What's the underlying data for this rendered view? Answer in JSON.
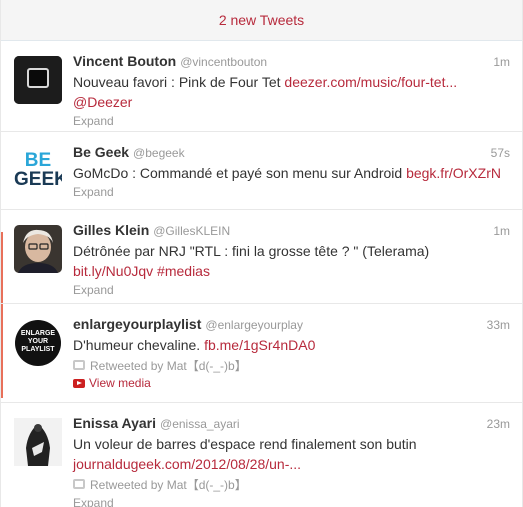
{
  "banner": {
    "label": "2 new Tweets"
  },
  "colors": {
    "accent": "#b72a3c",
    "muted": "#999999",
    "side_accent": "#e8705a"
  },
  "tweets": [
    {
      "fullname": "Vincent Bouton",
      "username": "@vincentbouton",
      "time": "1m",
      "text": "Nouveau favori : Pink de Four Tet ",
      "link": "deezer.com/music/four-tet...",
      "text_line2_link": "@Deezer",
      "expand": "Expand",
      "avatar_icon": "monitor-icon"
    },
    {
      "fullname": "Be Geek",
      "username": "@begeek",
      "time": "57s",
      "text": "GoMcDo : Commandé et payé son menu sur Android ",
      "link": "begk.fr/OrXZrN",
      "expand": "Expand",
      "avatar_line1": "BE",
      "avatar_line2": "GEEK"
    },
    {
      "fullname": "Gilles Klein",
      "username": "@GillesKLEIN",
      "time": "1m",
      "text": "Détrônée par NRJ \"RTL : fini la grosse tête ? \" (Telerama)",
      "link": "bit.ly/Nu0Jqv",
      "hashtag": "#medias",
      "expand": "Expand"
    },
    {
      "fullname": "enlargeyourplaylist",
      "username": "@enlargeyourplay",
      "time": "33m",
      "text": "D'humeur chevaline. ",
      "link": "fb.me/1gSr4nDA0",
      "retweeted_by": "Retweeted by Mat【d(-_-)b】",
      "media": "View media",
      "avatar_line1": "ENLARGE",
      "avatar_line2": "YOUR",
      "avatar_line3": "PLAYLIST"
    },
    {
      "fullname": "Enissa Ayari",
      "username": "@enissa_ayari",
      "time": "23m",
      "text": "Un voleur de barres d'espace rend finalement son butin",
      "link": "journaldugeek.com/2012/08/28/un-...",
      "retweeted_by": "Retweeted by Mat【d(-_-)b】",
      "expand": "Expand"
    }
  ]
}
